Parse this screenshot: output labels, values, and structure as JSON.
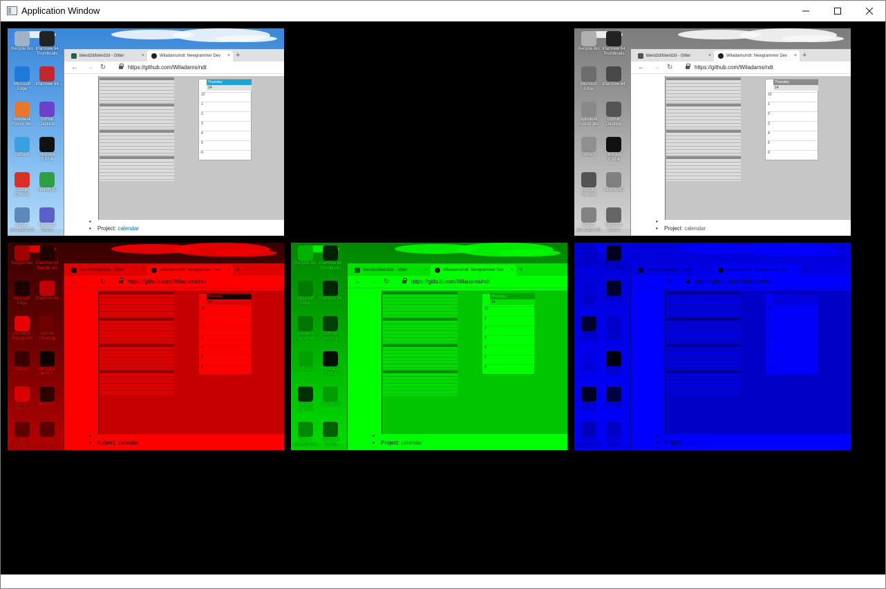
{
  "window": {
    "title": "Application Window",
    "controls": {
      "minimize": "minimize",
      "maximize": "maximize",
      "close": "close"
    }
  },
  "panels": [
    {
      "id": "original",
      "variant": "original"
    },
    {
      "id": "grayscale",
      "variant": "grayscale"
    },
    {
      "id": "red-channel",
      "variant": "red",
      "tint": "#ff0000"
    },
    {
      "id": "green-channel",
      "variant": "green",
      "tint": "#00ff00"
    },
    {
      "id": "blue-channel",
      "variant": "blue",
      "tint": "#0000ff"
    }
  ],
  "desktop": {
    "icons": [
      {
        "label": "Recycle Bin",
        "glyph": "recycle-bin-icon",
        "color": "#9fb3c8"
      },
      {
        "label": "IrfanView 64 Thumbnails",
        "glyph": "irfanview-thumbnails-icon",
        "color": "#222222"
      },
      {
        "label": "Microsoft Edge",
        "glyph": "edge-icon",
        "color": "#1e7ad6"
      },
      {
        "label": "IrfanView 64",
        "glyph": "irfanview-icon",
        "color": "#c0282e"
      },
      {
        "label": "Autodesk Fusion 360",
        "glyph": "fusion-360-icon",
        "color": "#e8762d"
      },
      {
        "label": "GitHub Desktop",
        "glyph": "github-desktop-icon",
        "color": "#6e40c9"
      },
      {
        "label": "GitBash",
        "glyph": "git-bash-icon",
        "color": "#3aa1e0"
      },
      {
        "label": "Inkscape 0.92.4",
        "glyph": "inkscape-icon",
        "color": "#111111"
      },
      {
        "label": "Google Chrome",
        "glyph": "chrome-icon",
        "color": "#d93025"
      },
      {
        "label": "Simplify3D",
        "glyph": "simplify3d-icon",
        "color": "#2f9e44"
      },
      {
        "label": "Nmap - Zenmap GUI",
        "glyph": "zenmap-icon",
        "color": "#5d88b8"
      },
      {
        "label": "Microsoft Teams",
        "glyph": "teams-icon",
        "color": "#5b5fc7"
      }
    ]
  },
  "browser": {
    "tabs": [
      {
        "label": "blend2d/blend2d - Gitter",
        "close": "×"
      },
      {
        "label": "Wiladams/ndt: Newgrammer Dev",
        "close": "×"
      }
    ],
    "new_tab": "+",
    "back": "←",
    "forward": "→",
    "reload": "↻",
    "url": "https://github.com/Wiladams/ndt",
    "day_view": {
      "title": "Thursday",
      "date": "14",
      "hours": [
        "12",
        "1",
        "2",
        "3",
        "4",
        "5",
        "6"
      ]
    },
    "bullet": "•",
    "project_prefix": "Project:",
    "project_link": "calendar"
  }
}
